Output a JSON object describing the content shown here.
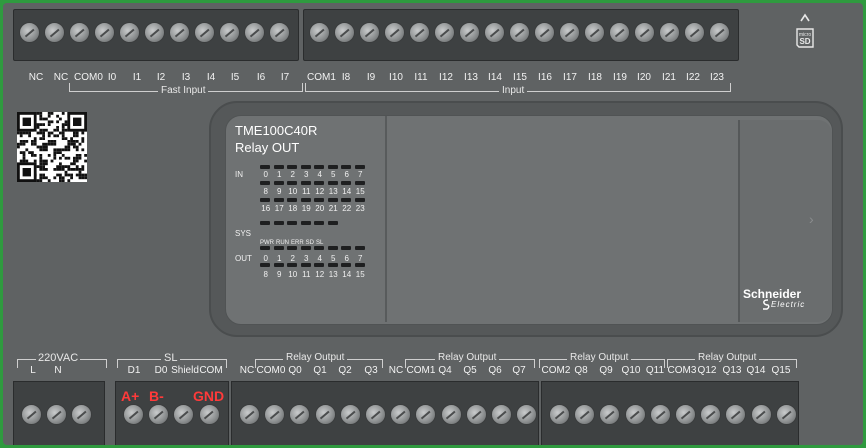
{
  "top_terminal_labels": [
    "NC",
    "NC",
    "COM0",
    "I0",
    "I1",
    "I2",
    "I3",
    "I4",
    "I5",
    "I6",
    "I7",
    "COM1",
    "I8",
    "I9",
    "I10",
    "I11",
    "I12",
    "I13",
    "I14",
    "I15",
    "I16",
    "I17",
    "I18",
    "I19",
    "I20",
    "I21",
    "I22",
    "I23"
  ],
  "top_groups": {
    "fast_input": "Fast Input",
    "input": "Input"
  },
  "model": {
    "name": "TME100C40R",
    "type": "Relay OUT"
  },
  "led_panel": {
    "in_label": "IN",
    "in_row1": [
      "0",
      "1",
      "2",
      "3",
      "4",
      "5",
      "6",
      "7"
    ],
    "in_row2": [
      "8",
      "9",
      "10",
      "11",
      "12",
      "13",
      "14",
      "15"
    ],
    "in_row3": [
      "16",
      "17",
      "18",
      "19",
      "20",
      "21",
      "22",
      "23"
    ],
    "sys_label": "SYS",
    "sys_items": [
      "PWR",
      "RUN",
      "ERR",
      "SD",
      "SL"
    ],
    "out_label": "OUT",
    "out_row1": [
      "0",
      "1",
      "2",
      "3",
      "4",
      "5",
      "6",
      "7"
    ],
    "out_row2": [
      "8",
      "9",
      "10",
      "11",
      "12",
      "13",
      "14",
      "15"
    ]
  },
  "brand": {
    "name": "Schneider",
    "sub": "Electric"
  },
  "sd_label": "micro SD",
  "bottom_groups": {
    "power": "220VAC",
    "sl": "SL",
    "relay1": "Relay Output",
    "relay2": "Relay Output",
    "relay3": "Relay Output",
    "relay4": "Relay Output"
  },
  "bottom_terminal_labels": [
    "L",
    "N",
    "D1",
    "D0",
    "Shield",
    "COM",
    "NC",
    "COM0",
    "Q0",
    "Q1",
    "Q2",
    "Q3",
    "NC",
    "COM1",
    "Q4",
    "Q5",
    "Q6",
    "Q7",
    "COM2",
    "Q8",
    "Q9",
    "Q10",
    "Q11",
    "COM3",
    "Q12",
    "Q13",
    "Q14",
    "Q15"
  ],
  "annotations": {
    "a_plus": "A+",
    "b_minus": "B-",
    "gnd": "GND"
  }
}
